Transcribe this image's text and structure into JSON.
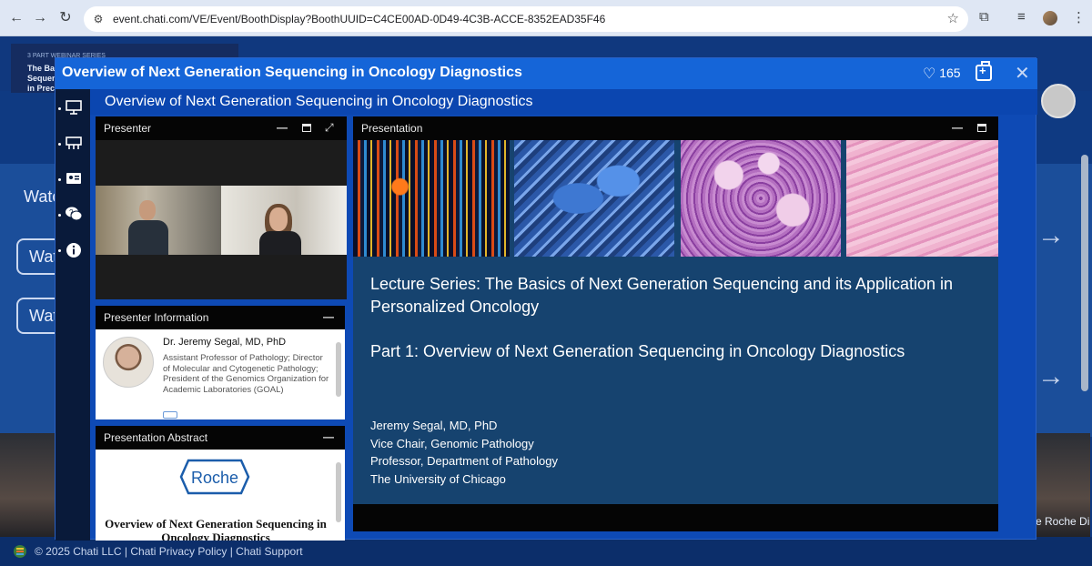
{
  "browser": {
    "url": "event.chati.com/VE/Event/BoothDisplay?BoothUUID=C4CE00AD-0D49-4C3B-ACCE-8352EAD35F46"
  },
  "background": {
    "banner_small": "3 PART WEBINAR SERIES",
    "banner_title": "The Basi Sequenc in Precis",
    "watch_heading": "Watc",
    "watch_buttons": [
      "Wat",
      "Wat"
    ],
    "roche_text": "e Roche Di",
    "footer": "© 2025 Chati LLC | Chati Privacy Policy | Chati Support"
  },
  "modal": {
    "title": "Overview of Next Generation Sequencing in Oncology Diagnostics",
    "likes": "165",
    "content_title": "Overview of Next Generation Sequencing in Oncology Diagnostics"
  },
  "panels": {
    "presenter": "Presenter",
    "presentation": "Presentation",
    "presenter_info": "Presenter Information",
    "abstract": "Presentation Abstract"
  },
  "presenter": {
    "name": "Dr. Jeremy Segal, MD, PhD",
    "title": "Assistant Professor of Pathology; Director of Molecular and Cytogenetic Pathology; President of the Genomics Organization for Academic Laboratories (GOAL)"
  },
  "abstract": {
    "logo": "Roche",
    "title": "Overview of Next Generation Sequencing in Oncology Diagnostics"
  },
  "slide": {
    "line1": "Lecture Series: The Basics of Next Generation Sequencing and its Application in Personalized Oncology",
    "line2": "Part 1: Overview of Next Generation Sequencing in Oncology Diagnostics",
    "author": [
      "Jeremy Segal, MD, PhD",
      "Vice Chair, Genomic Pathology",
      "Professor, Department of Pathology",
      "The University of Chicago"
    ]
  },
  "icons": [
    "back-icon",
    "forward-icon",
    "reload-icon",
    "site-info-icon",
    "star-icon",
    "extensions-icon",
    "media-icon",
    "menu-icon",
    "presentation-icon",
    "sessions-icon",
    "contact-card-icon",
    "chat-icon",
    "info-icon",
    "heart-icon",
    "briefcase-icon",
    "close-icon",
    "minimize-icon",
    "maximize-icon",
    "expand-icon"
  ]
}
